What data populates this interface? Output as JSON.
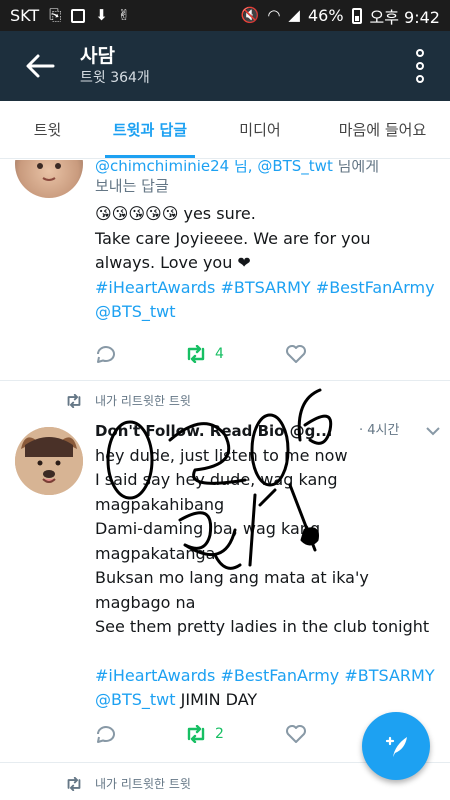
{
  "status_bar": {
    "carrier": "SKT",
    "battery": "46%",
    "time": "오후 9:42"
  },
  "app_bar": {
    "title": "사담",
    "subtitle": "트윗 364개"
  },
  "tabs": [
    {
      "label": "트윗"
    },
    {
      "label": "트윗과 답글",
      "active": true
    },
    {
      "label": "미디어"
    },
    {
      "label": "마음에 들어요"
    }
  ],
  "tweet1": {
    "reply_mention1": "@chimchiminie24 님, ",
    "reply_mention2": "@BTS_twt",
    "reply_suffix": " 님에게",
    "reply_line2": "보내는 답글",
    "emoji": "😘😘😘😘😘",
    "text_after_emoji": " yes sure.",
    "line2": "Take care Joyieeee. We are for you",
    "line3": "always. Love you ❤",
    "hashtags": "#iHeartAwards #BTSARMY #BestFanArmy",
    "mention": "@BTS_twt",
    "retweet_count": "4"
  },
  "tweet2": {
    "retweet_label": "내가 리트윗한 트윗",
    "author": "Don't Follow. Read Bio @g...",
    "time": "· 4시간",
    "lines": [
      "hey dude, just listen to me now",
      "I said say hey dude, wag kang",
      "magpakahibang",
      "Dami-daming iba, wag kang",
      "magpakatanga",
      "Buksan mo lang ang mata at ika'y",
      "magbago na",
      "See them pretty ladies in the club tonight"
    ],
    "hashtags": "#iHeartAwards #BestFanArmy #BTSARMY",
    "mention": "@BTS_twt",
    "trailing": " JIMIN DAY",
    "retweet_count": "2"
  },
  "tweet3": {
    "retweet_label": "내가 리트윗한 트윗"
  },
  "colors": {
    "app_bar": "#1d2f3d",
    "accent": "#1da1f2",
    "retweet_green": "#17bf63"
  }
}
